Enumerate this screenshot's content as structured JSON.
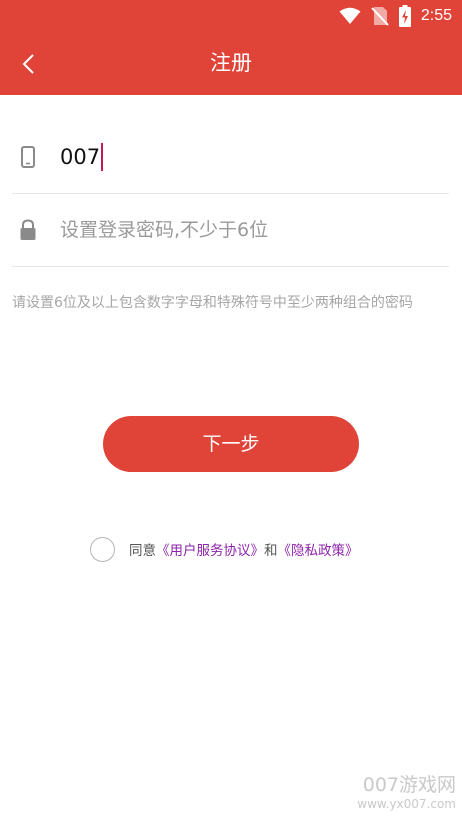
{
  "status_bar": {
    "time": "2:55",
    "icons": [
      "wifi-icon",
      "no-sim-icon",
      "battery-charging-icon"
    ]
  },
  "app_bar": {
    "back_icon": "chevron-left-icon",
    "title": "注册"
  },
  "form": {
    "phone": {
      "icon": "phone-icon",
      "value": "007"
    },
    "password": {
      "icon": "lock-icon",
      "placeholder": "设置登录密码,不少于6位"
    },
    "hint": "请设置6位及以上包含数字字母和特殊符号中至少两种组合的密码",
    "next_label": "下一步"
  },
  "agreement": {
    "prefix": "同意",
    "user_agreement": "《用户服务协议》",
    "conjunction": "和",
    "privacy_policy": "《隐私政策》"
  },
  "watermark": {
    "title": "007游戏网",
    "url": "www.yx007.com"
  },
  "colors": {
    "primary": "#e04438",
    "link": "#8e24aa",
    "caret": "#c2185b"
  }
}
